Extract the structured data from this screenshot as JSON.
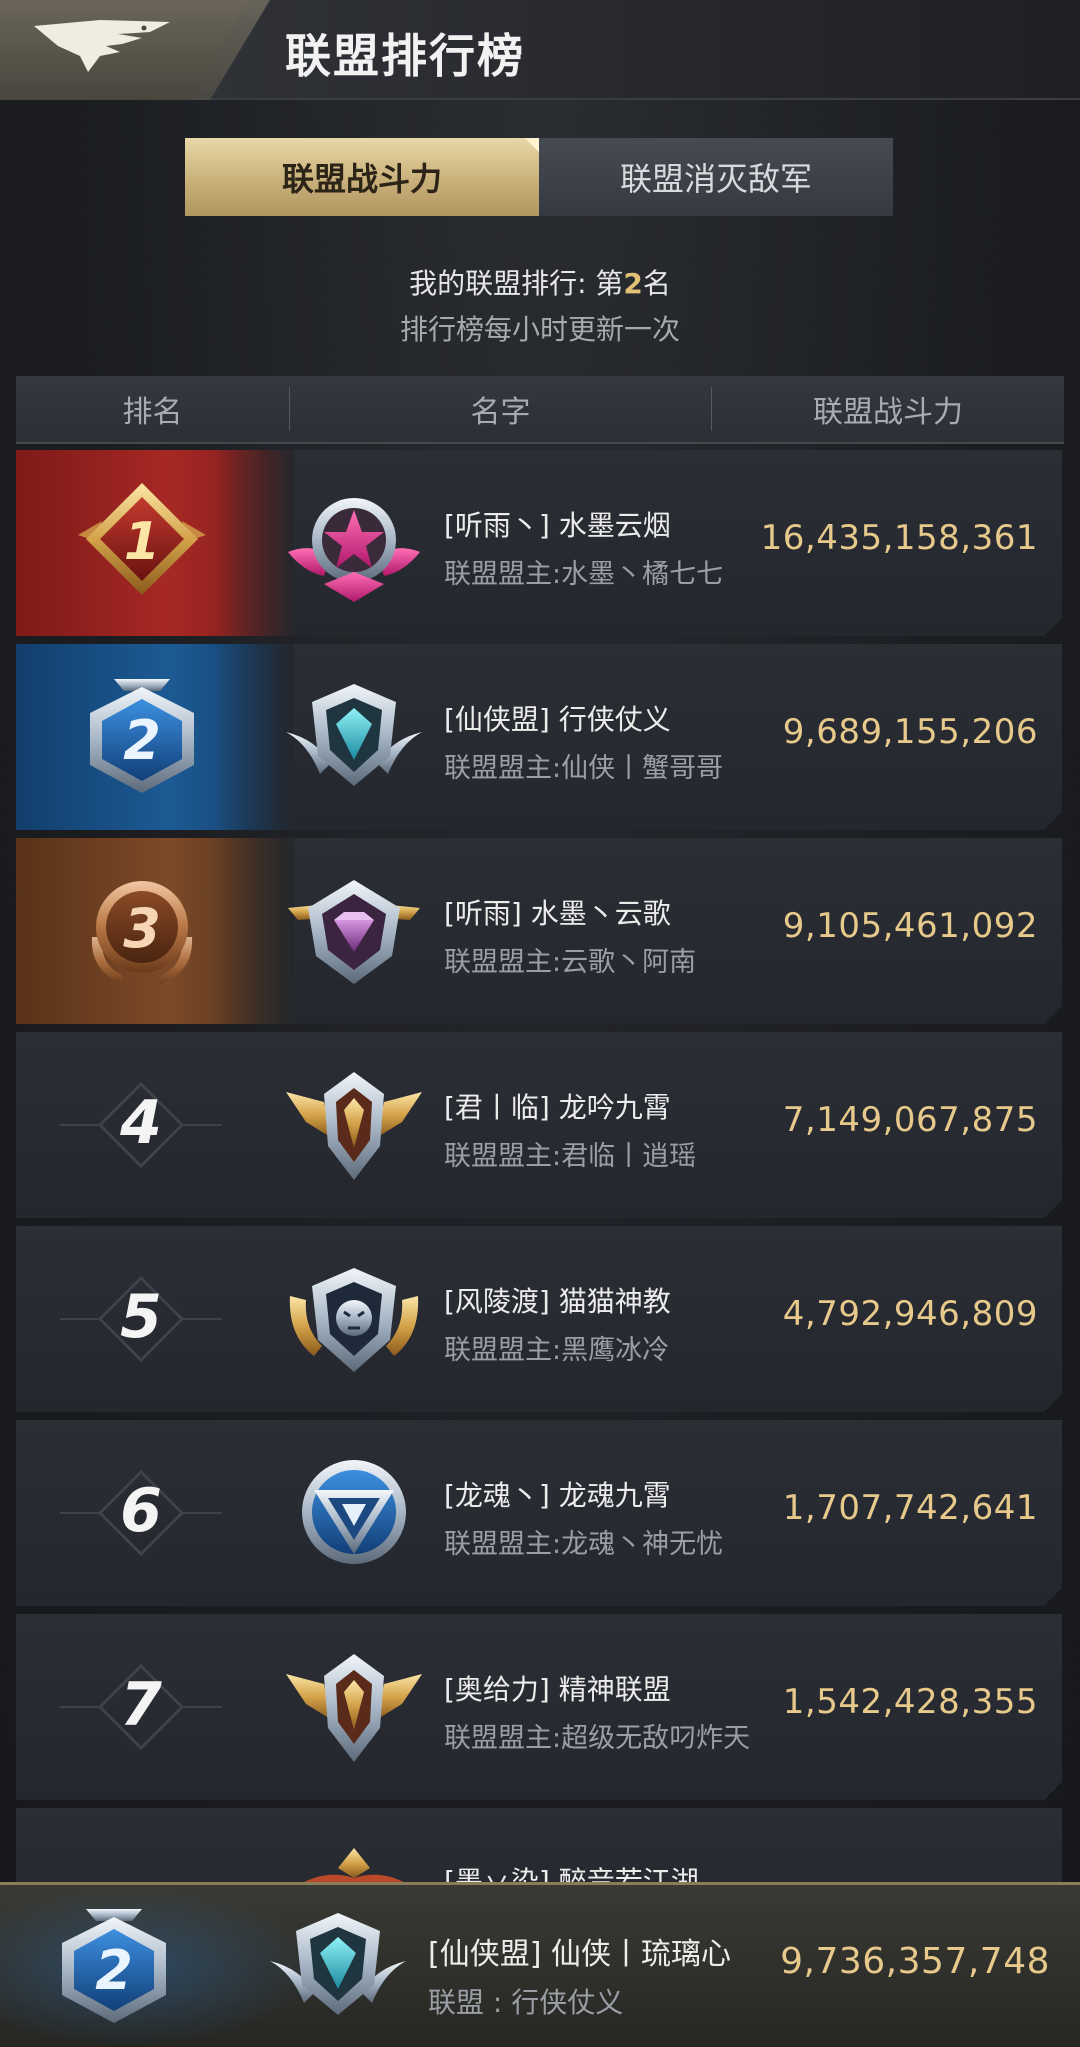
{
  "header": {
    "title": "联盟排行榜",
    "emblem_icon": "eagle-icon"
  },
  "tabs": [
    {
      "label": "联盟战斗力",
      "active": true
    },
    {
      "label": "联盟消灭敌军",
      "active": false
    }
  ],
  "info": {
    "my_rank_prefix": "我的联盟排行: 第",
    "my_rank_value": "2",
    "my_rank_suffix": "名",
    "update_note": "排行榜每小时更新一次"
  },
  "table": {
    "columns": [
      "排名",
      "名字",
      "联盟战斗力"
    ],
    "rows": [
      {
        "rank": "1",
        "name": "[听雨丶] 水墨云烟",
        "leader": "联盟盟主:水墨丶橘七七",
        "power": "16,435,158,361",
        "tier": "gold",
        "crest": "pink-star-crest-icon"
      },
      {
        "rank": "2",
        "name": "[仙侠盟] 行侠仗义",
        "leader": "联盟盟主:仙侠丨蟹哥哥",
        "power": "9,689,155,206",
        "tier": "silver",
        "crest": "cyan-winged-crest-icon"
      },
      {
        "rank": "3",
        "name": "[听雨] 水墨丶云歌",
        "leader": "联盟盟主:云歌丶阿南",
        "power": "9,105,461,092",
        "tier": "bronze",
        "crest": "diamond-crest-icon"
      },
      {
        "rank": "4",
        "name": "[君丨临] 龙吟九霄",
        "leader": "联盟盟主:君临丨逍瑶",
        "power": "7,149,067,875",
        "tier": "plain",
        "crest": "gold-winged-crest-icon"
      },
      {
        "rank": "5",
        "name": "[风陵渡] 猫猫神教",
        "leader": "联盟盟主:黑鹰冰冷",
        "power": "4,792,946,809",
        "tier": "plain",
        "crest": "lion-crest-icon"
      },
      {
        "rank": "6",
        "name": "[龙魂丶] 龙魂九霄",
        "leader": "联盟盟主:龙魂丶神无忧",
        "power": "1,707,742,641",
        "tier": "plain",
        "crest": "blue-eagle-crest-icon"
      },
      {
        "rank": "7",
        "name": "[奥给力] 精神联盟",
        "leader": "联盟盟主:超级无敌叼炸天",
        "power": "1,542,428,355",
        "tier": "plain",
        "crest": "gold-winged-crest-icon"
      },
      {
        "rank": "",
        "name": "[墨丷染] 醉音若江湖",
        "leader": "",
        "power": "",
        "tier": "plain",
        "crest": "orange-crest-icon"
      }
    ]
  },
  "my_alliance": {
    "rank": "2",
    "name": "[仙侠盟] 仙侠丨琉璃心",
    "alliance": "联盟 : 行侠仗义",
    "power": "9,736,357,748",
    "crest": "cyan-winged-crest-icon"
  },
  "colors": {
    "gold_text": "#e6c98b",
    "accent_tab": "#c9b07a"
  }
}
